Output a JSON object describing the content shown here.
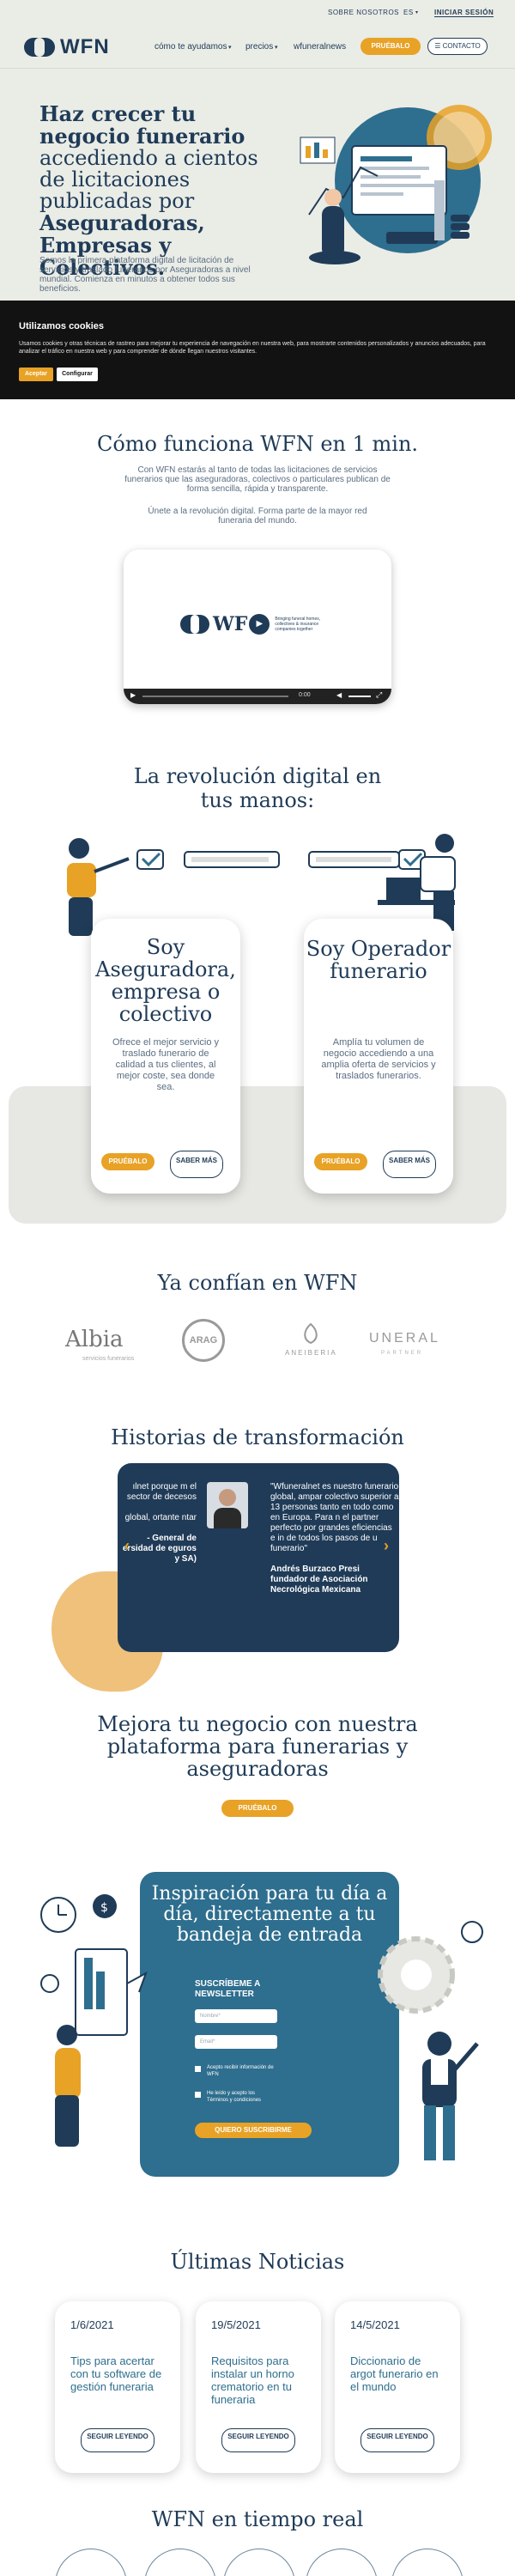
{
  "topbar": {
    "about": "SOBRE NOSOTROS",
    "lang": "ES",
    "login": "INICIAR SESIÓN"
  },
  "nav": {
    "logo": "WFN",
    "items": [
      "cómo te ayudamos",
      "precios",
      "wfuneralnews"
    ],
    "try": "PRUÉBALO",
    "contact": "CONTACTO"
  },
  "hero": {
    "title_1": "Haz crecer tu negocio",
    "title_2": "funerario",
    "title_3": " accediendo a cientos de licitaciones publicadas por ",
    "title_4": "Aseguradoras, Empresas y Colectivos.",
    "text": "Somos la primera plataforma digital de licitación de servicios y traslado funerarios por Aseguradoras a nivel mundial. Comienza en minutos a obtener todos sus beneficios."
  },
  "cookies": {
    "title": "Utilizamos cookies",
    "text": "Usamos cookies y otras técnicas de rastreo para mejorar tu experiencia de navegación en nuestra web, para mostrarte contenidos personalizados y anuncios adecuados, para analizar el tráfico en nuestra web y para comprender de dónde llegan nuestros visitantes.",
    "accept": "Aceptar",
    "configure": "Configurar"
  },
  "how": {
    "title": "Cómo funciona WFN en 1 min.",
    "text1": "Con WFN estarás al tanto de todas las licitaciones de servicios funerarios que las aseguradoras, colectivos o particulares publican de forma sencilla, rápida y transparente.",
    "text2": "Únete a la revolución digital. Forma parte de la mayor red funeraria del mundo.",
    "video_logo": "WF",
    "video_tagline": "Bringing funeral homes, collectives & insurance companies together",
    "video_time": "0:00"
  },
  "revolution": {
    "title": "La revolución digital en tus manos:",
    "cards": [
      {
        "title": "Soy Aseguradora, empresa o colectivo",
        "text": "Ofrece el mejor servicio y traslado funerario de calidad a tus clientes, al mejor coste, sea donde sea.",
        "try": "PRUÉBALO",
        "more": "SABER MÁS"
      },
      {
        "title": "Soy Operador funerario",
        "text": "Amplía tu volumen de negocio accediendo a una amplia oferta de servicios y traslados funerarios.",
        "try": "PRUÉBALO",
        "more": "SABER MÁS"
      }
    ]
  },
  "trust": {
    "title": "Ya confían en WFN",
    "logos": [
      "Albia",
      "ARAG",
      "ANEIBERIA",
      "UNERAL"
    ],
    "logo_subs": [
      "servicios funerarios",
      "",
      "",
      "PARTNER"
    ]
  },
  "stories": {
    "title": "Historias de transformación",
    "left_text": "ılnet porque m el sector de decesos",
    "left_text2": "global, ortante ntar",
    "left_author": "- General de ersidad de eguros y SA)",
    "right_text": "\"Wfuneralnet es nuestro funerario global, ampar colectivo superior a 13 personas tanto en todo como en Europa. Para n el partner perfecto por grandes eficiencias e in de todos los pasos de u funerario\"",
    "right_author": "Andrés Burzaco  Presi fundador de Asociación Necrológica Mexicana"
  },
  "improve": {
    "title": "Mejora tu negocio con nuestra plataforma para funerarias y aseguradoras",
    "try": "PRUÉBALO"
  },
  "newsletter": {
    "title": "Inspiración para tu día a día, directamente a tu bandeja de entrada",
    "subtitle": "SUSCRÍBEME A NEWSLETTER",
    "name_ph": "Nombre*",
    "email_ph": "Email*",
    "check1": "Acepto recibir información de WFN",
    "check2": "He leído y acepto los Términos y condiciones",
    "submit": "QUIERO SUSCRIBIRME"
  },
  "news": {
    "title": "Últimas Noticias",
    "items": [
      {
        "date": "1/6/2021",
        "title": "Tips para acertar con tu software de gestión funeraria",
        "more": "SEGUIR LEYENDO"
      },
      {
        "date": "19/5/2021",
        "title": "Requisitos para instalar un horno crematorio en tu funeraria",
        "more": "SEGUIR LEYENDO"
      },
      {
        "date": "14/5/2021",
        "title": "Diccionario de argot funerario en el mundo",
        "more": "SEGUIR LEYENDO"
      }
    ]
  },
  "realtime": {
    "title": "WFN en tiempo real"
  },
  "colors": {
    "navy": "#1f3b57",
    "amber": "#e8a226",
    "teal": "#2e6e8e",
    "beige": "#eaece6"
  }
}
